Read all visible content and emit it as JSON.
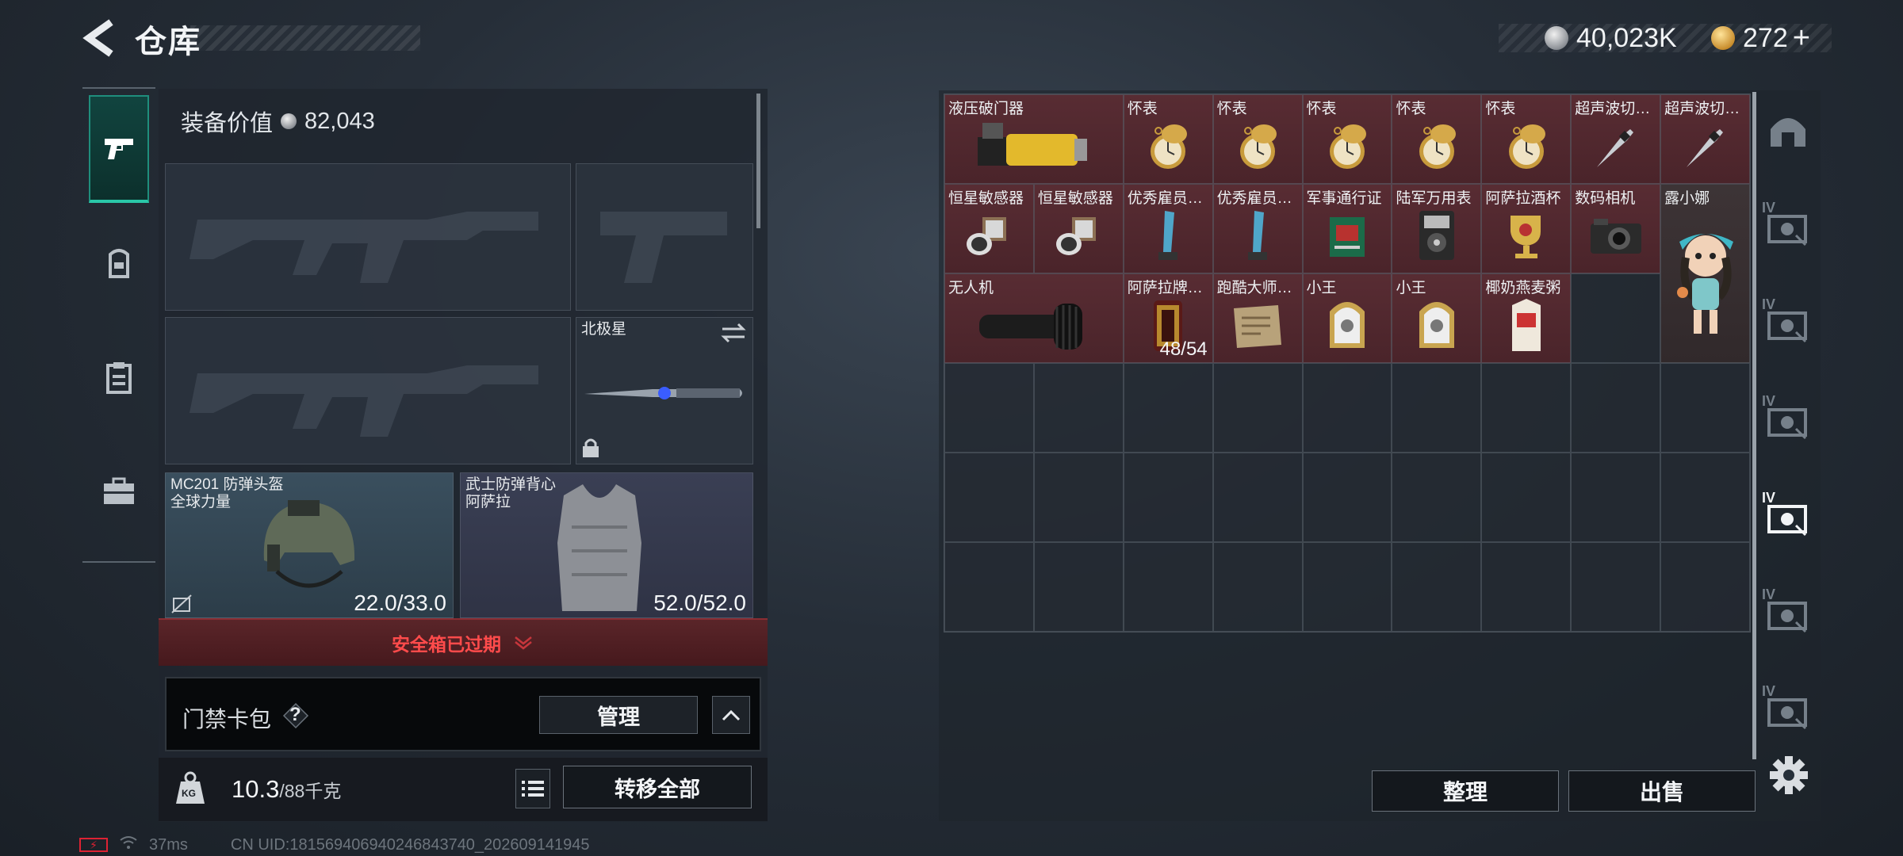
{
  "header": {
    "title": "仓库",
    "currencies": [
      {
        "name": "silver-coin",
        "value": "40,023K"
      },
      {
        "name": "gold-coin",
        "value": "272",
        "suffix": "+"
      }
    ]
  },
  "left_rail": {
    "tabs": [
      {
        "icon": "pistol-icon",
        "active": true
      },
      {
        "icon": "backpack-icon",
        "active": false
      },
      {
        "icon": "clipboard-icon",
        "active": false
      },
      {
        "icon": "briefcase-icon",
        "active": false
      }
    ]
  },
  "loadout": {
    "equip_value_label": "装备价值",
    "equip_value": "82,043",
    "slots": {
      "primary1": {
        "label": ""
      },
      "secondary": {
        "label": ""
      },
      "primary2": {
        "label": ""
      },
      "melee": {
        "label": "北极星"
      }
    },
    "helmet": {
      "name": "MC201 防弹头盔",
      "sub": "全球力量",
      "durability": "22.0/33.0"
    },
    "vest": {
      "name": "武士防弹背心",
      "sub": "阿萨拉",
      "durability": "52.0/52.0"
    },
    "safe_box_status": "安全箱已过期",
    "keycard": {
      "label": "门禁卡包",
      "help": "?",
      "manage": "管理"
    },
    "weight": {
      "current": "10.3",
      "max": "/88千克",
      "icon_label": "KG"
    },
    "transfer_all": "转移全部"
  },
  "stash": {
    "items": [
      {
        "name": "液压破门器",
        "art": "breacher",
        "wide": true
      },
      {
        "name": "怀表",
        "art": "pocketwatch"
      },
      {
        "name": "怀表",
        "art": "pocketwatch"
      },
      {
        "name": "怀表",
        "art": "pocketwatch"
      },
      {
        "name": "怀表",
        "art": "pocketwatch"
      },
      {
        "name": "怀表",
        "art": "pocketwatch"
      },
      {
        "name": "超声波切割刀",
        "art": "scalpel"
      },
      {
        "name": "超声波切割刀",
        "art": "scalpel"
      },
      {
        "name": "恒星敏感器",
        "art": "sensor"
      },
      {
        "name": "恒星敏感器",
        "art": "sensor"
      },
      {
        "name": "优秀雇员奖杯",
        "art": "trophy"
      },
      {
        "name": "优秀雇员奖杯",
        "art": "trophy"
      },
      {
        "name": "军事通行证",
        "art": "pass"
      },
      {
        "name": "陆军万用表",
        "art": "multimeter"
      },
      {
        "name": "阿萨拉酒杯",
        "art": "goblet"
      },
      {
        "name": "数码相机",
        "art": "camera"
      },
      {
        "name": "露小娜",
        "art": "figure",
        "tall": true
      },
      {
        "name": "无人机",
        "art": "drone",
        "wide": true
      },
      {
        "name": "阿萨拉牌香烟",
        "art": "cigarettes",
        "count": "48/54"
      },
      {
        "name": "跑酷大师证书",
        "art": "certificate"
      },
      {
        "name": "小王",
        "art": "card"
      },
      {
        "name": "小王",
        "art": "card"
      },
      {
        "name": "椰奶燕麦粥",
        "art": "carton"
      }
    ],
    "sort_label": "整理",
    "sell_label": "出售"
  },
  "right_rail": {
    "tabs": [
      {
        "icon": "dome-icon",
        "badge": ""
      },
      {
        "icon": "camera-box-icon",
        "badge": "IV"
      },
      {
        "icon": "camera-box-icon",
        "badge": "IV"
      },
      {
        "icon": "camera-box-icon",
        "badge": "IV"
      },
      {
        "icon": "camera-box-icon",
        "badge": "IV",
        "active": true
      },
      {
        "icon": "camera-box-icon",
        "badge": "IV"
      },
      {
        "icon": "camera-box-icon",
        "badge": "IV"
      }
    ]
  },
  "status_bar": {
    "ping": "37ms",
    "uid": "CN UID:18156940694024684374​0_202609141945"
  },
  "colors": {
    "accent_teal": "#2ac7a8",
    "item_bg": "#582c33",
    "warning_red": "#ff4b4b"
  }
}
